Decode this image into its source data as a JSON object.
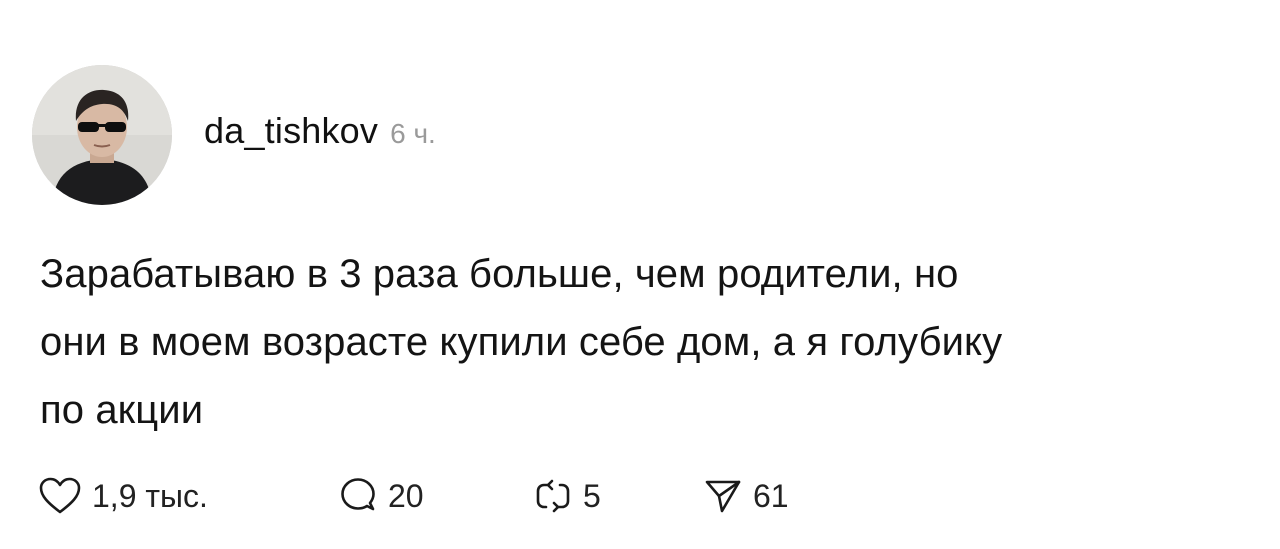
{
  "post": {
    "username": "da_tishkov",
    "time": "6 ч.",
    "text_lines": [
      "Зарабатываю в 3 раза больше, чем родители, но",
      "они в моем возрасте купили себе дом, а я голубику",
      "по акции"
    ],
    "actions": {
      "likes": "1,9 тыс.",
      "replies": "20",
      "reposts": "5",
      "shares": "61"
    }
  },
  "icons": {
    "like": "heart-icon",
    "reply": "comment-icon",
    "repost": "repost-icon",
    "share": "send-icon"
  },
  "colors": {
    "text": "#141414",
    "muted": "#9a9a9a",
    "background": "#ffffff"
  }
}
